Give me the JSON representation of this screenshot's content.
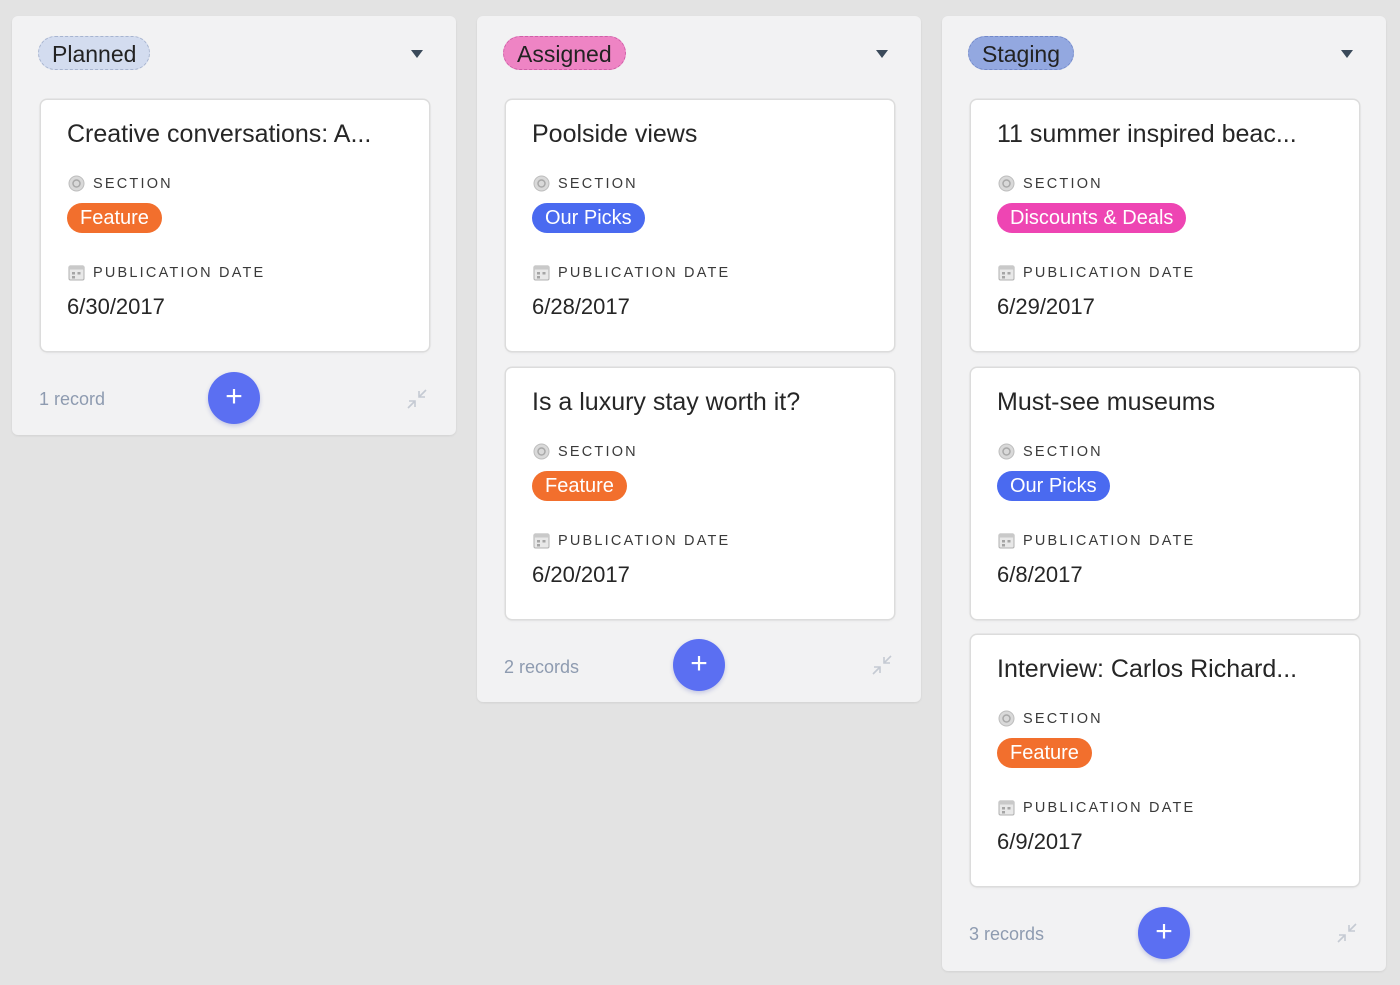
{
  "colors": {
    "feature": "#f26f2d",
    "our_picks": "#4a6af0",
    "discounts": "#ee45b3",
    "add_button": "#5b6ff2",
    "planned_pill": "#d3dcef",
    "assigned_pill": "#ee84c4",
    "staging_pill": "#93a8e0"
  },
  "columns": [
    {
      "stage": "Planned",
      "count": "1 record",
      "cards": [
        {
          "title": "Creative conversations: A...",
          "section_label": "SECTION",
          "section": "Feature",
          "date_label": "PUBLICATION DATE",
          "date": "6/30/2017"
        }
      ]
    },
    {
      "stage": "Assigned",
      "count": "2 records",
      "cards": [
        {
          "title": "Poolside views",
          "section_label": "SECTION",
          "section": "Our Picks",
          "date_label": "PUBLICATION DATE",
          "date": "6/28/2017"
        },
        {
          "title": "Is a luxury stay worth it?",
          "section_label": "SECTION",
          "section": "Feature",
          "date_label": "PUBLICATION DATE",
          "date": "6/20/2017"
        }
      ]
    },
    {
      "stage": "Staging",
      "count": "3 records",
      "cards": [
        {
          "title": "11 summer inspired beac...",
          "section_label": "SECTION",
          "section": "Discounts & Deals",
          "date_label": "PUBLICATION DATE",
          "date": "6/29/2017"
        },
        {
          "title": "Must-see museums",
          "section_label": "SECTION",
          "section": "Our Picks",
          "date_label": "PUBLICATION DATE",
          "date": "6/8/2017"
        },
        {
          "title": "Interview: Carlos Richard...",
          "section_label": "SECTION",
          "section": "Feature",
          "date_label": "PUBLICATION DATE",
          "date": "6/9/2017"
        }
      ]
    }
  ],
  "add_label": "+"
}
